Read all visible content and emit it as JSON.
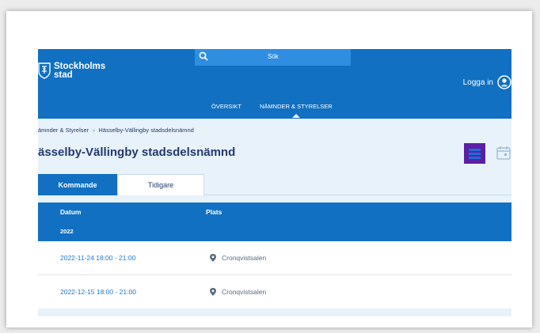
{
  "header": {
    "logo_text": "Stockholms\nstad",
    "search_label": "Sök",
    "login_label": "Logga in",
    "nav": [
      "ÖVERSIKT",
      "NÄMNDER & STYRELSER"
    ]
  },
  "breadcrumb": {
    "items": [
      "ämnder & Styrelser",
      "Hässelby-Vällingby stadsdelsnämnd"
    ],
    "separator": "»"
  },
  "page_title": "ässelby-Vällingby stadsdelsnämnd",
  "tabs": [
    "Kommande",
    "Tidigare"
  ],
  "table": {
    "columns": [
      "Datum",
      "Plats"
    ],
    "year": "2022",
    "rows": [
      {
        "date": "2022-11-24 18:00 - 21:00",
        "place": "Cronqvistsalen"
      },
      {
        "date": "2022-12-15 18:00 - 21:00",
        "place": "Cronqvistsalen"
      }
    ]
  },
  "colors": {
    "brand_blue": "#1170c2",
    "light_blue": "#e8f2fb",
    "list_button": "#5b1fa3"
  },
  "icons": [
    "crest-icon",
    "search-icon",
    "user-icon",
    "list-view-icon",
    "calendar-icon",
    "location-pin-icon"
  ]
}
